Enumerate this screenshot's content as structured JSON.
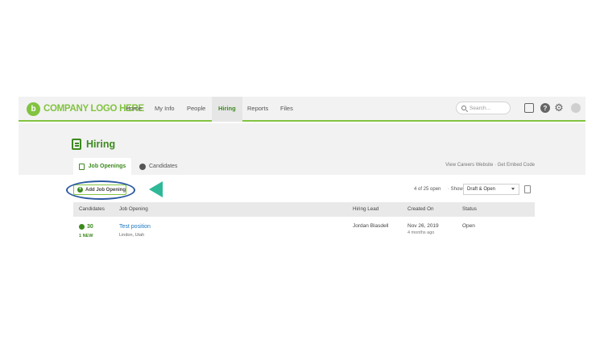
{
  "nav": {
    "logo_mark": "b",
    "logo_text": "COMPANY LOGO HERE",
    "items": [
      {
        "label": "Home"
      },
      {
        "label": "My Info"
      },
      {
        "label": "People"
      },
      {
        "label": "Hiring",
        "active": true
      },
      {
        "label": "Reports"
      },
      {
        "label": "Files"
      }
    ],
    "search_placeholder": "Search...",
    "icons": [
      "inbox-icon",
      "help-icon",
      "gear-icon",
      "avatar"
    ],
    "help_glyph": "?",
    "gear_glyph": "⚙"
  },
  "page": {
    "title": "Hiring",
    "tabs": [
      {
        "label": "Job Openings",
        "active": true
      },
      {
        "label": "Candidates"
      }
    ],
    "links": "View Careers Website · Get Embed Code"
  },
  "toolbar": {
    "add_button_label": "Add Job Opening",
    "count_text": "4 of 25 open",
    "show_label": "· Show",
    "filter_value": "Draft & Open"
  },
  "table": {
    "headers": [
      "Candidates",
      "Job Opening",
      "Hiring Lead",
      "Created On",
      "Status"
    ],
    "rows": [
      {
        "candidates": "30",
        "new_badge": "1 NEW",
        "title": "Test position",
        "location": "Lindon, Utah",
        "hiring_lead": "Jordan Blasdell",
        "created_on": "Nov 26, 2019",
        "created_ago": "4 months ago",
        "status": "Open"
      }
    ]
  },
  "colors": {
    "brand_green": "#82c341",
    "dark_green": "#3d8a1e",
    "link_blue": "#1a78c2",
    "highlight_ring": "#2c5aa0",
    "pointer_arrow": "#2eb898"
  }
}
